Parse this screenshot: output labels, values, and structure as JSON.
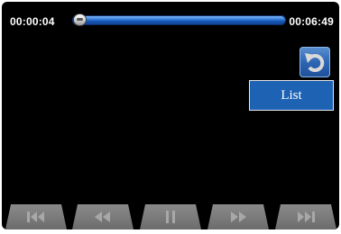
{
  "player": {
    "elapsed_time": "00:00:04",
    "total_time": "00:06:49",
    "progress_fraction": 0.01
  },
  "overlay": {
    "list_label": "List",
    "back_icon": "undo-arrow-icon"
  },
  "controls": {
    "buttons": [
      {
        "name": "skip-previous-button",
        "icon": "skip-previous-icon"
      },
      {
        "name": "rewind-button",
        "icon": "rewind-icon"
      },
      {
        "name": "pause-button",
        "icon": "pause-icon"
      },
      {
        "name": "fast-forward-button",
        "icon": "fast-forward-icon"
      },
      {
        "name": "skip-next-button",
        "icon": "skip-next-icon"
      }
    ]
  },
  "colors": {
    "background": "#000000",
    "accent_blue": "#1e62b4",
    "control_gray": "#7a7a7a",
    "icon_gray": "#a8a8a8"
  }
}
